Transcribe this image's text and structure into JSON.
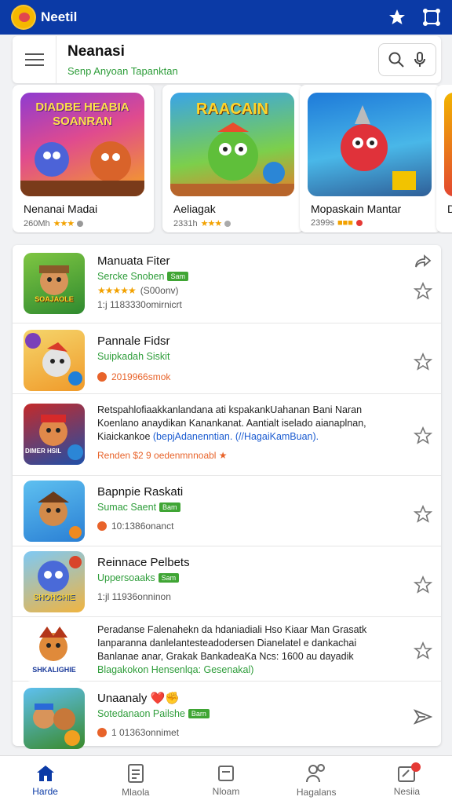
{
  "app": {
    "title": "Neetil"
  },
  "header": {
    "title": "Neanasi",
    "subtitle": "Senp Anyoan Tapanktan"
  },
  "featured": [
    {
      "art_text": "DIADBE HEABIA SOANRAN",
      "name": "Nenanai Madai",
      "count": "260Mh",
      "stars": "★★★",
      "accent": "#7b3fb9"
    },
    {
      "art_text": "RAACAIN",
      "name": "Aeliagak",
      "count": "2331h",
      "stars": "★★★",
      "accent": "#e94d2d"
    },
    {
      "art_text": "",
      "name": "Mopaskain Mantar",
      "count": "2399s",
      "stars": "■■■",
      "accent": "#1f7fd8"
    },
    {
      "art_text": "",
      "name": "D",
      "count": "",
      "stars": "",
      "accent": "#f2b400"
    }
  ],
  "list": [
    {
      "title": "Manuata Fiter",
      "subtitle": "Sercke Snoben",
      "badge": "Sam",
      "stars": "★★★★★",
      "rating_text": "(S00onv)",
      "meta": "1:j 1183330omirnicrt",
      "art_text": "SOAJAOLE"
    },
    {
      "title": "Pannale Fidsr",
      "subtitle": "Suipkadah Siskit",
      "badge": "",
      "meta": "2019966smok",
      "art_text": ""
    },
    {
      "title": "",
      "desc_lines": [
        "Retspahlofiaakkanlandana ati kspakankUahanan Bani Naran",
        "Koenlano anaydikan Kanankanat. Aantialt iselado aianaplnan,"
      ],
      "desc_tail": "Kiaickankoe",
      "desc_link": "(bepjAdanenntian. (//HagaiKamBuan).",
      "meta": "Renden $2 9 oedenmnnoabl ★",
      "art_text": "DIMER HSIL"
    },
    {
      "title": "Bapnpie Raskati",
      "subtitle": "Sumac Saent",
      "badge": "Bam",
      "meta": "10:1386onanct",
      "art_text": ""
    },
    {
      "title": "Reinnace Pelbets",
      "subtitle": "Uppersoaaks",
      "badge": "Sam",
      "meta": "1:jl 11936onninon",
      "art_text": "SHOHGHIE"
    },
    {
      "title": "",
      "desc_lines": [
        "Peradanse Falenahekn da hdaniadiali Hso Kiaar Man Grasatk",
        "Ianparanna danlelantesteadodersen Dianelatel e dankachai",
        "Banlanae anar, Grakak BankadeaKa Ncs: 1600 au dayadik"
      ],
      "desc_link": "Blagakokon Hensenlqa: Gesenakal)",
      "meta": "",
      "art_text": "SHKALIGHIE"
    },
    {
      "title": "Unaanaly",
      "title_emoji": "❤️✊",
      "subtitle": "Sotedanaon Pailshe",
      "badge": "Barn",
      "meta": "1 01363onnimet",
      "art_text": ""
    }
  ],
  "nav": [
    {
      "label": "Harde",
      "icon": "home-icon",
      "active": true
    },
    {
      "label": "Mlaola",
      "icon": "document-icon",
      "active": false
    },
    {
      "label": "Nloam",
      "icon": "square-icon",
      "active": false
    },
    {
      "label": "Hagalans",
      "icon": "people-icon",
      "active": false
    },
    {
      "label": "Nesiia",
      "icon": "news-icon",
      "active": false
    }
  ]
}
